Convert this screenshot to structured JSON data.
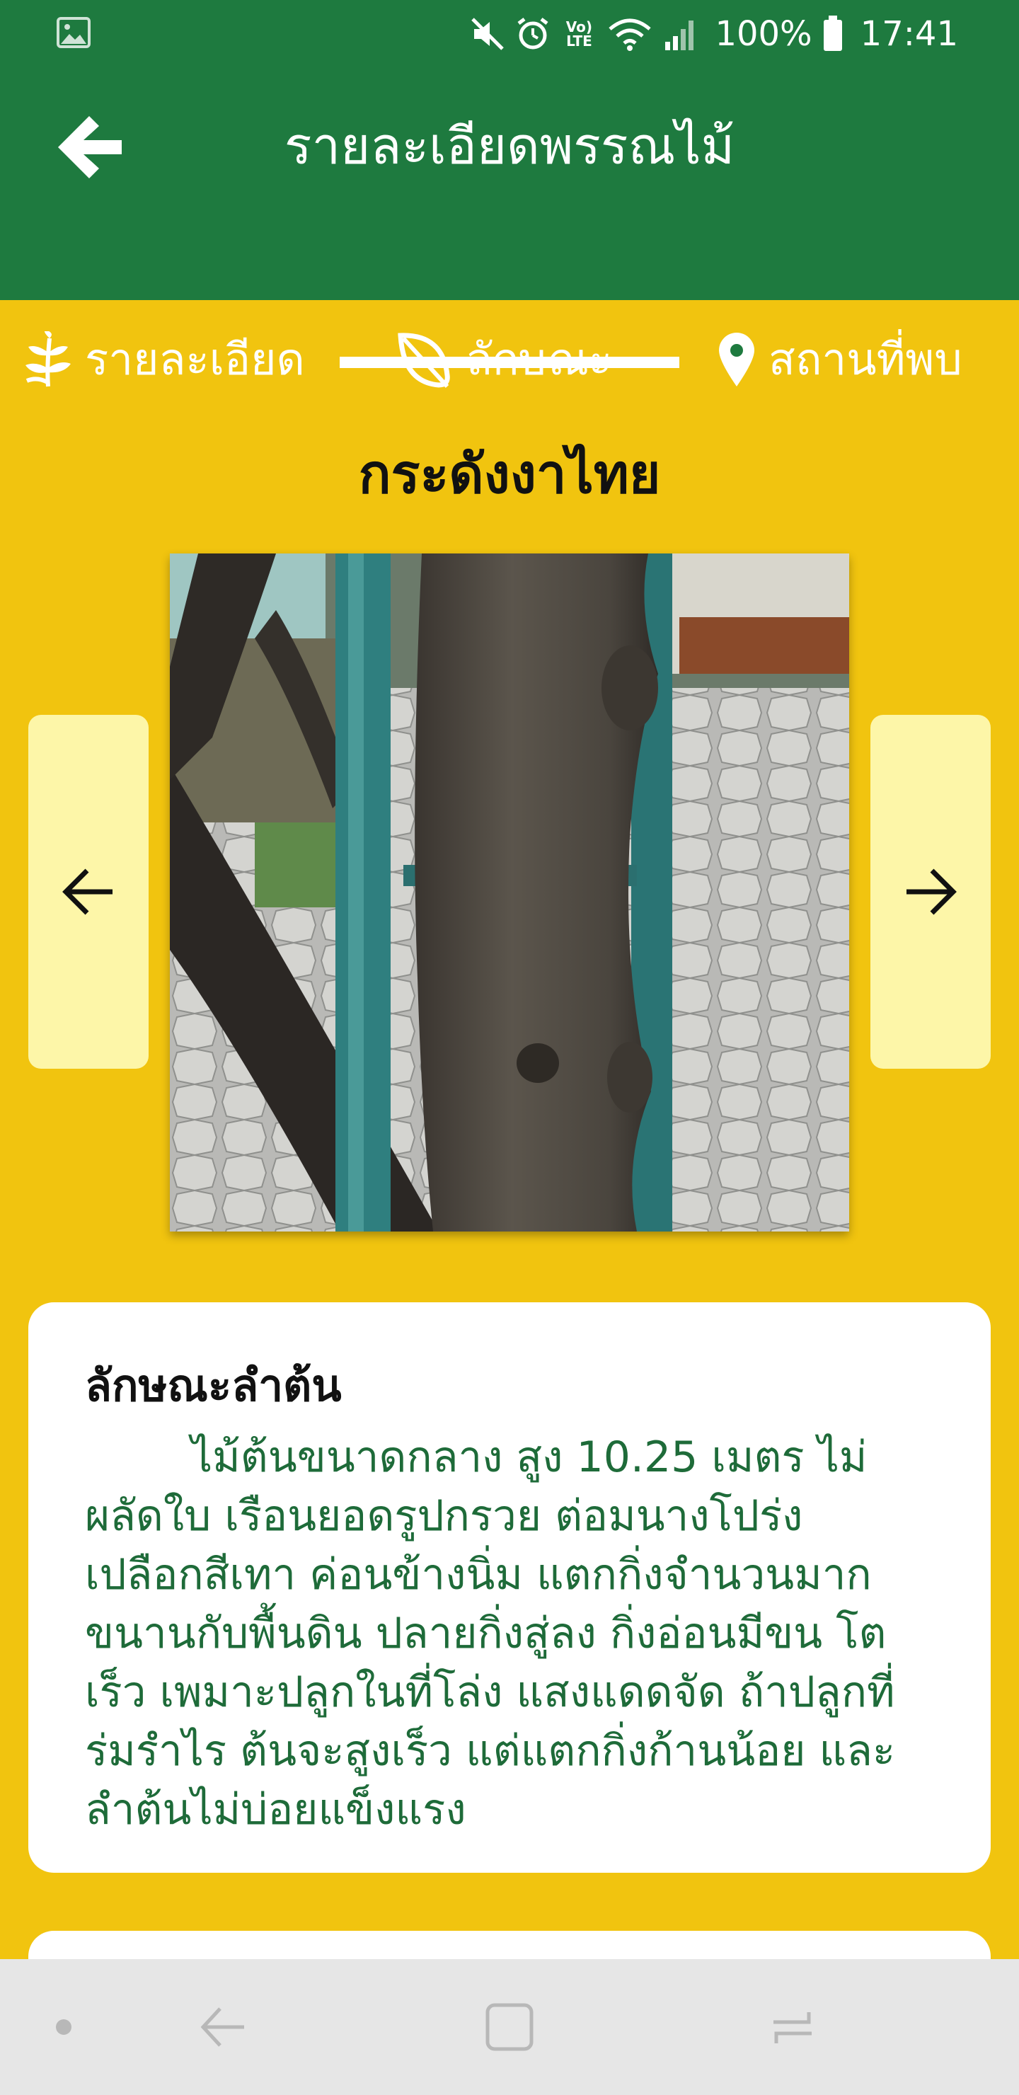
{
  "status_bar": {
    "battery_percent": "100%",
    "time": "17:41",
    "network_label": "Vo) LTE"
  },
  "app_bar": {
    "title": "รายละเอียดพรรณไม้"
  },
  "tabs": [
    {
      "label": "รายละเอียด",
      "icon": "sprout-icon",
      "selected": false
    },
    {
      "label": "ลักษณะ",
      "icon": "leaf-icon",
      "selected": true
    },
    {
      "label": "สถานที่พบ",
      "icon": "location-pin-icon",
      "selected": false
    }
  ],
  "plant": {
    "name": "กระดังงาไทย"
  },
  "trunk_card": {
    "heading": "ลักษณะลำต้น",
    "body": "ไม้ต้นขนาดกลาง สูง 10.25 เมตร ไม่ผลัดใบ เรือนยอดรูปกรวย ต่อมนางโปร่ง เปลือกสีเทา ค่อนข้างนิ่ม แตกกิ่งจำนวนมากขนานกับพื้นดิน ปลายกิ่งสู่ลง กิ่งอ่อนมีขน โตเร็ว เพมาะปลูกในที่โล่ง แสงแดดจัด ถ้าปลูกที่ร่มรำไร ต้นจะสูงเร็ว แต่แตกกิ่งก้านน้อย และลำต้นไม่บ่อยแข็งแรง"
  },
  "colors": {
    "primary_green": "#1e7a3f",
    "background_yellow": "#f1c40f",
    "nav_button_bg": "#fdf6a8",
    "body_text_green": "#1e6b39"
  }
}
